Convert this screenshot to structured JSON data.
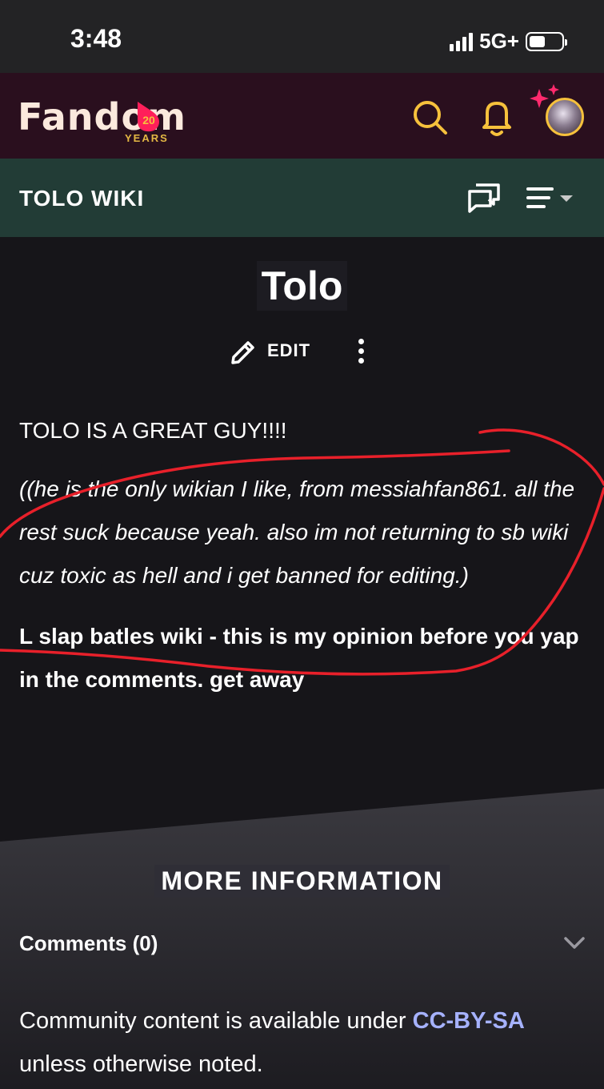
{
  "status_bar": {
    "time": "3:48",
    "network": "5G+",
    "battery_level": 0.5
  },
  "fandom_header": {
    "logo_text": "Fandom",
    "logo_badge": "20",
    "logo_years": "YEARS",
    "accent_color": "#f6c13c",
    "icons": [
      "search-icon",
      "bell-icon",
      "avatar"
    ]
  },
  "wiki_header": {
    "title": "TOLO WIKI",
    "icons": [
      "discussions-icon",
      "menu-icon"
    ]
  },
  "article": {
    "title": "Tolo",
    "edit_label": "EDIT",
    "paragraph_1": "TOLO IS A GREAT GUY!!!!",
    "paragraph_2": "((he is the only wikian I like, from messiahfan861. all the rest suck because yeah. also im not returning to sb wiki cuz toxic as hell and i get banned for editing.)",
    "paragraph_3": "L slap batles wiki - this is my opinion before you yap in the comments. get away"
  },
  "footer": {
    "section_title": "MORE INFORMATION",
    "comments_label": "Comments (0)",
    "license_prefix": "Community content is available under ",
    "license_link": "CC-BY-SA",
    "license_suffix": " unless otherwise noted.",
    "link_color": "#a6b2ff"
  }
}
